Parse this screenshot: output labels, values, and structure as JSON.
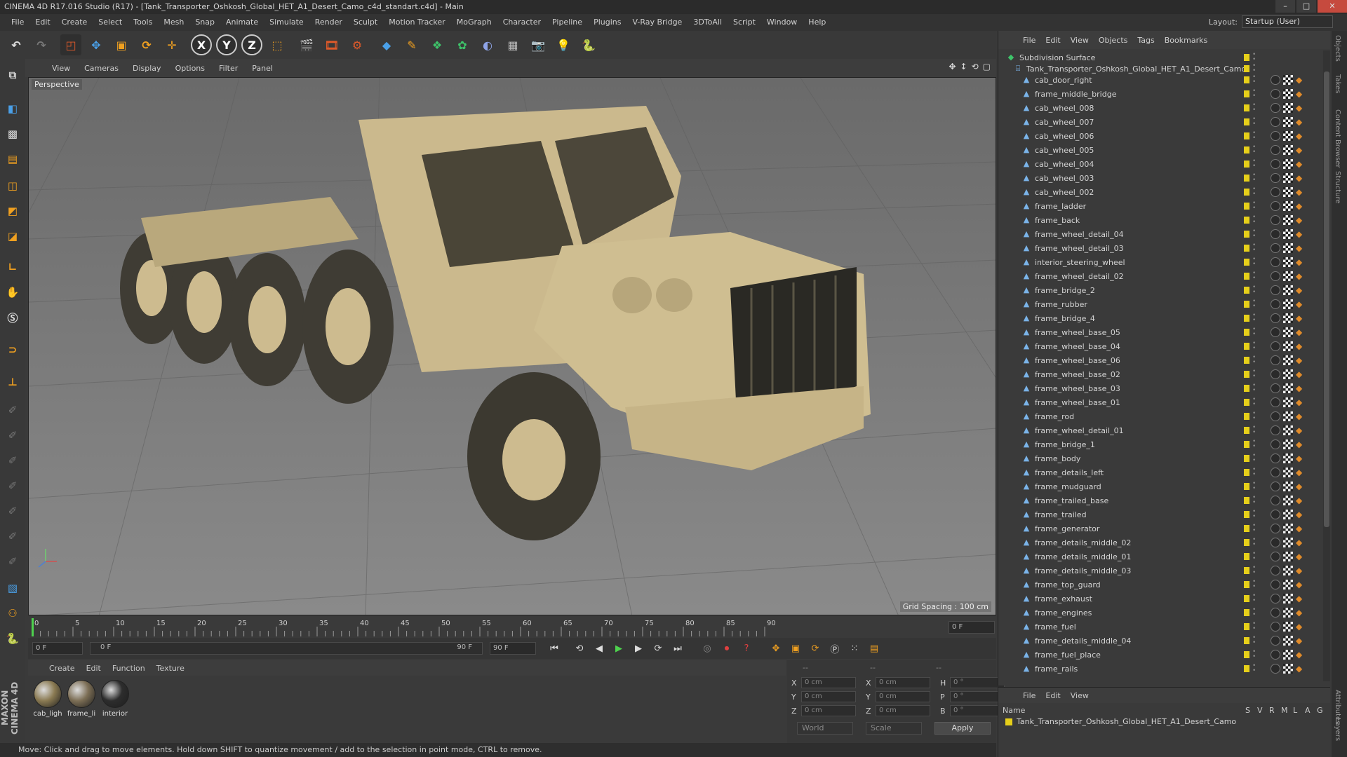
{
  "window": {
    "title": "CINEMA 4D R17.016 Studio (R17) - [Tank_Transporter_Oshkosh_Global_HET_A1_Desert_Camo_c4d_standart.c4d] - Main"
  },
  "menu": [
    "File",
    "Edit",
    "Create",
    "Select",
    "Tools",
    "Mesh",
    "Snap",
    "Animate",
    "Simulate",
    "Render",
    "Sculpt",
    "Motion Tracker",
    "MoGraph",
    "Character",
    "Pipeline",
    "Plugins",
    "V-Ray Bridge",
    "3DToAll",
    "Script",
    "Window",
    "Help"
  ],
  "layout": {
    "label": "Layout:",
    "value": "Startup (User)"
  },
  "toolbar_axes": [
    "X",
    "Y",
    "Z"
  ],
  "viewport": {
    "menu": [
      "View",
      "Cameras",
      "Display",
      "Options",
      "Filter",
      "Panel"
    ],
    "label": "Perspective",
    "grid_spacing": "Grid Spacing : 100 cm"
  },
  "timeline": {
    "ticks": [
      "0",
      "5",
      "10",
      "15",
      "20",
      "25",
      "30",
      "35",
      "40",
      "45",
      "50",
      "55",
      "60",
      "65",
      "70",
      "75",
      "80",
      "85",
      "90"
    ],
    "current_frame": "0 F",
    "end_field": "0 F"
  },
  "transport": {
    "start": "0 F",
    "range_start": "0 F",
    "range_end": "90 F",
    "end": "90 F"
  },
  "material_panel": {
    "menu": [
      "Create",
      "Edit",
      "Function",
      "Texture"
    ],
    "materials": [
      {
        "name": "cab_ligh",
        "color": "#8a7a52"
      },
      {
        "name": "frame_li",
        "color": "#7c6e55"
      },
      {
        "name": "interior",
        "color": "#2d2d2d"
      }
    ]
  },
  "coords": {
    "headers": [
      "--",
      "--",
      "--"
    ],
    "rows": [
      {
        "a": "X",
        "av": "0 cm",
        "b": "X",
        "bv": "0 cm",
        "c": "H",
        "cv": "0 °"
      },
      {
        "a": "Y",
        "av": "0 cm",
        "b": "Y",
        "bv": "0 cm",
        "c": "P",
        "cv": "0 °"
      },
      {
        "a": "Z",
        "av": "0 cm",
        "b": "Z",
        "bv": "0 cm",
        "c": "B",
        "cv": "0 °"
      }
    ],
    "space": "World",
    "mode": "Scale",
    "apply": "Apply"
  },
  "status": "Move: Click and drag to move elements. Hold down SHIFT to quantize movement / add to the selection in point mode, CTRL to remove.",
  "brand": "MAXON CINEMA 4D",
  "object_manager": {
    "menu": [
      "File",
      "Edit",
      "View",
      "Objects",
      "Tags",
      "Bookmarks"
    ],
    "root": "Subdivision Surface",
    "group": "Tank_Transporter_Oshkosh_Global_HET_A1_Desert_Camo",
    "objects": [
      "cab_door_right",
      "frame_middle_bridge",
      "cab_wheel_008",
      "cab_wheel_007",
      "cab_wheel_006",
      "cab_wheel_005",
      "cab_wheel_004",
      "cab_wheel_003",
      "cab_wheel_002",
      "frame_ladder",
      "frame_back",
      "frame_wheel_detail_04",
      "frame_wheel_detail_03",
      "interior_steering_wheel",
      "frame_wheel_detail_02",
      "frame_bridge_2",
      "frame_rubber",
      "frame_bridge_4",
      "frame_wheel_base_05",
      "frame_wheel_base_04",
      "frame_wheel_base_06",
      "frame_wheel_base_02",
      "frame_wheel_base_03",
      "frame_wheel_base_01",
      "frame_rod",
      "frame_wheel_detail_01",
      "frame_bridge_1",
      "frame_body",
      "frame_details_left",
      "frame_mudguard",
      "frame_trailed_base",
      "frame_trailed",
      "frame_generator",
      "frame_details_middle_02",
      "frame_details_middle_01",
      "frame_details_middle_03",
      "frame_top_guard",
      "frame_exhaust",
      "frame_engines",
      "frame_fuel",
      "frame_details_middle_04",
      "frame_fuel_place",
      "frame_rails"
    ]
  },
  "layer_manager": {
    "menu": [
      "File",
      "Edit",
      "View"
    ],
    "columns": [
      "Name",
      "S",
      "V",
      "R",
      "M",
      "L",
      "A",
      "G"
    ],
    "row": "Tank_Transporter_Oshkosh_Global_HET_A1_Desert_Camo"
  },
  "right_tabs": [
    "Objects",
    "Takes",
    "Content Browser",
    "Structure",
    "Attributes",
    "Layers"
  ],
  "colors": {
    "accent": "#e6cf1a",
    "bg": "#3a3a3a",
    "truck_tan": "#c9b88c"
  }
}
